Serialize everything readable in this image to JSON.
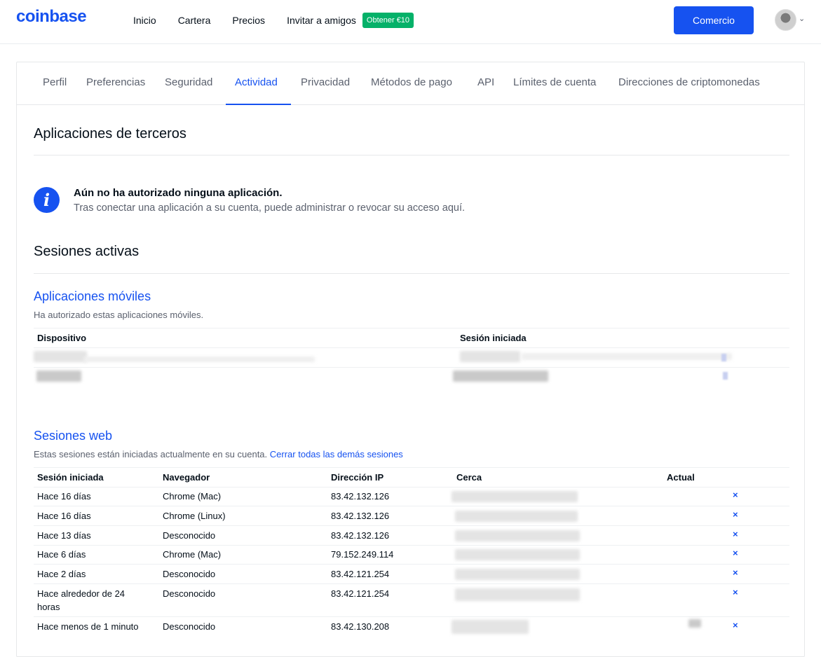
{
  "brand": {
    "logo": "coinbase"
  },
  "nav": {
    "links": [
      "Inicio",
      "Cartera",
      "Precios",
      "Invitar a amigos"
    ],
    "promo_badge": "Obtener €10",
    "trade_button": "Comercio"
  },
  "tabs": [
    {
      "label": "Perfil",
      "active": false
    },
    {
      "label": "Preferencias",
      "active": false
    },
    {
      "label": "Seguridad",
      "active": false
    },
    {
      "label": "Actividad",
      "active": true
    },
    {
      "label": "Privacidad",
      "active": false
    },
    {
      "label": "Métodos de pago",
      "active": false
    },
    {
      "label": "API",
      "active": false
    },
    {
      "label": "Límites de cuenta",
      "active": false
    },
    {
      "label": "Direcciones de criptomonedas",
      "active": false
    }
  ],
  "third_party": {
    "title": "Aplicaciones de terceros",
    "info_title": "Aún no ha autorizado ninguna aplicación.",
    "info_desc": "Tras conectar una aplicación a su cuenta, puede administrar o revocar su acceso aquí."
  },
  "sessions": {
    "title": "Sesiones activas",
    "mobile": {
      "title": "Aplicaciones móviles",
      "desc": "Ha autorizado estas aplicaciones móviles.",
      "columns": [
        "Dispositivo",
        "Sesión iniciada"
      ]
    },
    "web": {
      "title": "Sesiones web",
      "desc": "Estas sesiones están iniciadas actualmente en su cuenta.",
      "close_all_link": "Cerrar todas las demás sesiones",
      "columns": [
        "Sesión iniciada",
        "Navegador",
        "Dirección IP",
        "Cerca",
        "Actual"
      ],
      "revoke_symbol": "×",
      "rows": [
        {
          "started": "Hace 16 días",
          "browser": "Chrome (Mac)",
          "ip": "83.42.132.126"
        },
        {
          "started": "Hace 16 días",
          "browser": "Chrome (Linux)",
          "ip": "83.42.132.126"
        },
        {
          "started": "Hace 13 días",
          "browser": "Desconocido",
          "ip": "83.42.132.126"
        },
        {
          "started": "Hace 6 días",
          "browser": "Chrome (Mac)",
          "ip": "79.152.249.114"
        },
        {
          "started": "Hace 2 días",
          "browser": "Desconocido",
          "ip": "83.42.121.254"
        },
        {
          "started": "Hace alrededor de 24 horas",
          "browser": "Desconocido",
          "ip": "83.42.121.254"
        },
        {
          "started": "Hace menos de 1 minuto",
          "browser": "Desconocido",
          "ip": "83.42.130.208"
        }
      ]
    }
  },
  "colors": {
    "accent": "#1652f0",
    "promo": "#05b169",
    "muted": "#5b616e"
  },
  "icons": [
    "info-icon",
    "chevron-down-icon",
    "close-icon",
    "avatar"
  ]
}
